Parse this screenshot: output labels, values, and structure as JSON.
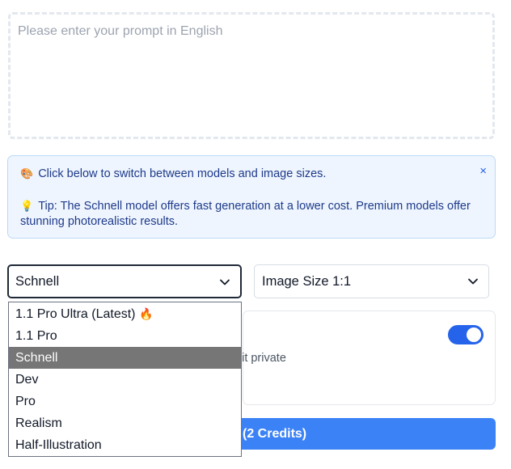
{
  "prompt": {
    "placeholder": "Please enter your prompt in English"
  },
  "tip": {
    "line1_icon": "🎨",
    "line1": "Click below to switch between models and image sizes.",
    "line2_icon": "💡",
    "line2": "Tip: The Schnell model offers fast generation at a lower cost. Premium models offer stunning photorealistic results.",
    "close": "×"
  },
  "model_select": {
    "value": "Schnell",
    "options": [
      {
        "label": "1.1 Pro Ultra (Latest)",
        "badge": "🔥"
      },
      {
        "label": "1.1 Pro"
      },
      {
        "label": "Schnell",
        "selected": true
      },
      {
        "label": "Dev"
      },
      {
        "label": "Pro"
      },
      {
        "label": "Realism"
      },
      {
        "label": "Half-Illustration"
      }
    ]
  },
  "size_select": {
    "value": "Image Size 1:1"
  },
  "private": {
    "text": "e it private",
    "toggle_on": true
  },
  "generate": {
    "label": "(2 Credits)"
  },
  "colors": {
    "accent": "#3b82f6",
    "toggle": "#2563eb",
    "tip_bg": "#eef5fe",
    "tip_text": "#1e3a8a",
    "selected_option_bg": "#767676"
  },
  "icons": {
    "select_chevron": "chevron-down-icon",
    "tip_close": "close-icon",
    "palette": "palette-icon",
    "bulb": "lightbulb-icon",
    "fire": "fire-icon"
  }
}
